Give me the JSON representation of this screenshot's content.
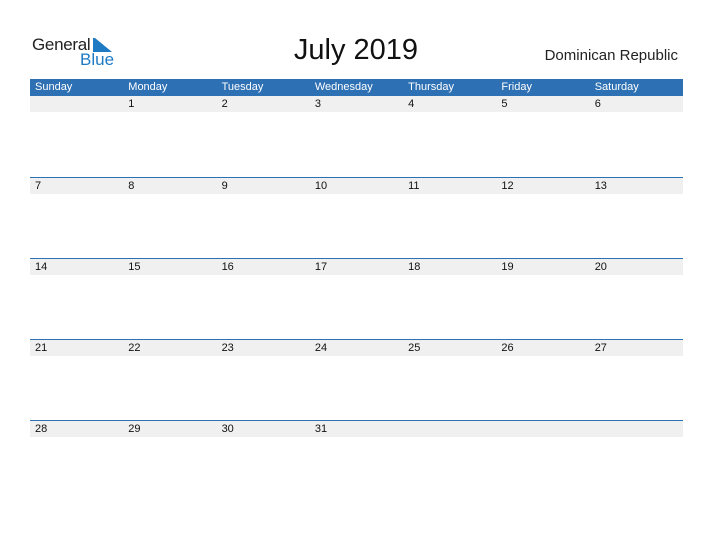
{
  "logo": {
    "general": "General",
    "blue": "Blue"
  },
  "title": "July 2019",
  "country": "Dominican Republic",
  "days": [
    "Sunday",
    "Monday",
    "Tuesday",
    "Wednesday",
    "Thursday",
    "Friday",
    "Saturday"
  ],
  "weeks": [
    [
      "",
      "1",
      "2",
      "3",
      "4",
      "5",
      "6"
    ],
    [
      "7",
      "8",
      "9",
      "10",
      "11",
      "12",
      "13"
    ],
    [
      "14",
      "15",
      "16",
      "17",
      "18",
      "19",
      "20"
    ],
    [
      "21",
      "22",
      "23",
      "24",
      "25",
      "26",
      "27"
    ],
    [
      "28",
      "29",
      "30",
      "31",
      "",
      "",
      ""
    ]
  ],
  "colors": {
    "accent": "#2e70b4",
    "logo_blue": "#1f7ac4",
    "date_strip": "#f0f0f0"
  }
}
